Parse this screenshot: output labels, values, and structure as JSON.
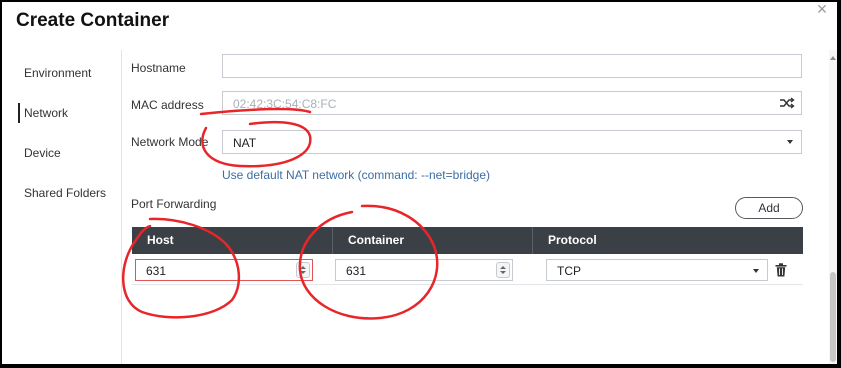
{
  "dialog": {
    "title": "Create Container",
    "close_icon": "close-icon"
  },
  "sidebar": {
    "items": [
      {
        "label": "Environment",
        "active": false
      },
      {
        "label": "Network",
        "active": true
      },
      {
        "label": "Device",
        "active": false
      },
      {
        "label": "Shared Folders",
        "active": false
      }
    ]
  },
  "network": {
    "hostname_label": "Hostname",
    "hostname_value": "",
    "mac_label": "MAC address",
    "mac_placeholder": "02:42:3C:54:C8:FC",
    "mac_icon": "shuffle-icon",
    "mode_label": "Network Mode",
    "mode_value": "NAT",
    "mode_hint": "Use default NAT network (command: --net=bridge)"
  },
  "port_forwarding": {
    "label": "Port Forwarding",
    "add_label": "Add",
    "columns": [
      "Host",
      "Container",
      "Protocol"
    ],
    "rows": [
      {
        "host": "631",
        "container": "631",
        "protocol": "TCP"
      }
    ]
  },
  "colors": {
    "header_bg": "#3b4046",
    "link": "#3b6ea5",
    "annotation": "#e8262a",
    "error": "#e05555"
  }
}
